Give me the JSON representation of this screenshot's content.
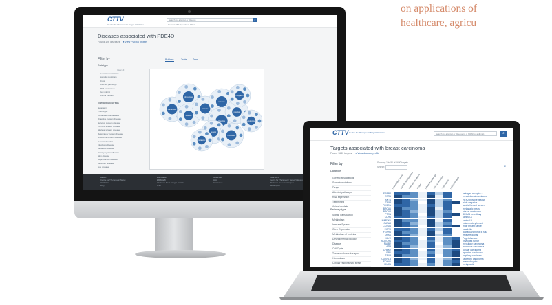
{
  "background_text": {
    "line1": "on applications of",
    "line2": "healthcare, agricu"
  },
  "desktop": {
    "logo": "CTTV",
    "logo_sub": "Centre for Therapeutic Target Validation",
    "search_placeholder": "Search for a target or disease",
    "search_example": "Example: BRAF, asthma, PTK2",
    "page_title": "Diseases associated with PDE4D",
    "subtitle": "Found 126 diseases",
    "profile_link": "View PDE4D profile",
    "filter_by": "Filter by",
    "datatype_label": "Datatype",
    "clear_all": "Clear all",
    "datatype_items": [
      "Genetic associations",
      "Somatic mutations",
      "Drugs",
      "Affected pathways",
      "RNA expression",
      "Text mining",
      "Animal models"
    ],
    "therapeutic_label": "Therapeutic Areas",
    "therapeutic_items": [
      "Neoplasm",
      "Phenotype",
      "Cardiovascular disease",
      "Digestive system disease",
      "Nervous system disease",
      "Immune system disease",
      "Skeletal system disease",
      "Respiratory system disease",
      "Endocrine system disease",
      "Genetic disorder",
      "Infectious disease",
      "Metabolic disease",
      "Urinary system disease",
      "Skin disease",
      "Reproductive disease",
      "Muscular disease",
      "Eye disease"
    ],
    "tabs": [
      "Bubbles",
      "Table",
      "Tree"
    ],
    "legend_label": "Score",
    "bubbles": [
      {
        "label": "cardiovasc",
        "color": "#2f66a6"
      },
      {
        "label": "phenotype",
        "color": "#2f66a6"
      },
      {
        "label": "skeletal",
        "color": "#2f66a6"
      },
      {
        "label": "immune",
        "color": "#2f66a6"
      },
      {
        "label": "nervous",
        "color": "#2f66a6"
      },
      {
        "label": "digestive",
        "color": "#2f66a6"
      },
      {
        "label": "respirat",
        "color": "#2f66a6"
      },
      {
        "label": "neoplasm",
        "color": "#2f66a6"
      },
      {
        "label": "endocrine",
        "color": "#2f66a6"
      },
      {
        "label": "genetic",
        "color": "#2f66a6"
      },
      {
        "label": "infectious",
        "color": "#2f66a6"
      },
      {
        "label": "metabolic",
        "color": "#2f66a6"
      }
    ],
    "footer": [
      {
        "head": "ABOUT",
        "items": [
          "Centre for Therapeutic Target",
          "Validation",
          "FAQ"
        ]
      },
      {
        "head": "PARTNERS",
        "items": [
          "EMBL-EBI",
          "Wellcome Trust Sanger Institute",
          "GSK"
        ]
      },
      {
        "head": "SUPPORT",
        "items": [
          "Help",
          "Contact us"
        ]
      },
      {
        "head": "CONTACT",
        "items": [
          "Centre for Therapeutic Target Validation",
          "Wellcome Genome Campus",
          "Hinxton, UK"
        ]
      }
    ]
  },
  "laptop": {
    "logo": "CTTV",
    "logo_sub": "Centre for Therapeutic Target Validation",
    "search_placeholder": "Search for a target or disease (e.g. BRAF or asthma)",
    "page_title": "Targets associated with breast carcinoma",
    "subtitle": "Found 1680 targets",
    "profile_link": "View disease profile",
    "filter_by": "Filter by",
    "datatype_label": "Datatype",
    "datatype_items": [
      "Genetic associations",
      "Somatic mutations",
      "Drugs",
      "Affected pathways",
      "RNA expression",
      "Text mining",
      "Animal models"
    ],
    "pathway_label": "Pathway type",
    "pathway_items": [
      "Signal Transduction",
      "Metabolism",
      "Immune System",
      "Gene Expression",
      "Metabolism of proteins",
      "Developmental Biology",
      "Disease",
      "Cell Cycle",
      "Transmembrane transport",
      "Hemostasis",
      "Cellular responses to stress",
      "Chromatin organization",
      "Extracellular matrix organization",
      "Vesicle-mediated transport"
    ],
    "showing": "Showing 1 to 50 of 1680 targets",
    "search_label": "Search:",
    "columns": [
      "Association score",
      "Genetic associations",
      "Somatic mutations",
      "Drugs",
      "Affected pathways",
      "RNA expression",
      "Text mining",
      "Animal models"
    ],
    "genes": [
      "ERBB2",
      "ESR1",
      "AKT1",
      "TP53",
      "PIK3CA",
      "BRCA1",
      "BRCA2",
      "PTEN",
      "CDH1",
      "MAP3K1",
      "GATA3",
      "CCND1",
      "EGFR",
      "FGFR1",
      "KRAS",
      "MYC",
      "NOTCH1",
      "PALB2",
      "ATM",
      "CHEK2",
      "RB1",
      "TBX3",
      "CDKN1B",
      "FOXA1",
      "MUC1"
    ],
    "diseases": [
      "estrogen receptor +",
      "breast ductal carcinoma",
      "HER2-positive breast",
      "triple-negative",
      "familial breast cancer",
      "metastatic breast",
      "lobular carcinoma",
      "BRCA1 hereditary",
      "luminal A",
      "luminal B",
      "inflammatory breast",
      "male breast cancer",
      "basal-like",
      "ductal carcinoma in situ",
      "invasive ductal",
      "Paget disease",
      "phyllodes tumor",
      "medullary carcinoma",
      "mucinous carcinoma",
      "tubular carcinoma",
      "apocrine carcinoma",
      "papillary carcinoma",
      "secretory carcinoma",
      "adenoid cystic",
      "metaplastic"
    ]
  }
}
